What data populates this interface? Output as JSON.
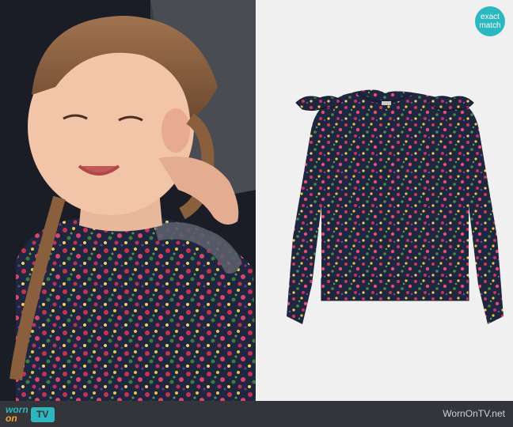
{
  "badge": {
    "line1": "exact",
    "line2": "match"
  },
  "footer": {
    "logo_line1": "worn",
    "logo_line2": "on",
    "logo_tv": "TV",
    "site_name": "WornOnTV.net"
  },
  "watermark": "wornontv.net",
  "colors": {
    "badge": "#2bb8c0",
    "footer_bg": "#33353b",
    "logo_teal": "#2fb5be",
    "logo_orange": "#f5a623",
    "shirt_base": "#1f2740"
  }
}
